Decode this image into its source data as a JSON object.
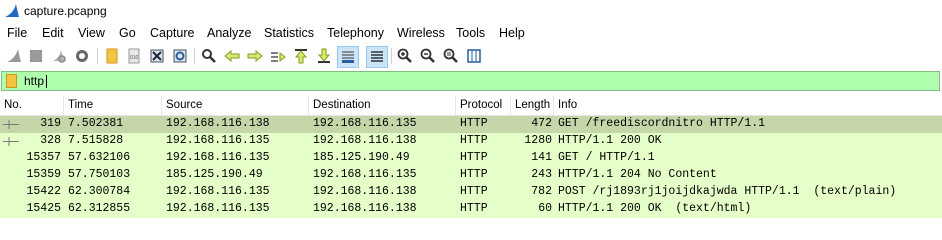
{
  "window": {
    "title": "capture.pcapng"
  },
  "menu": [
    "File",
    "Edit",
    "View",
    "Go",
    "Capture",
    "Analyze",
    "Statistics",
    "Telephony",
    "Wireless",
    "Tools",
    "Help"
  ],
  "toolbar": {
    "icons": [
      "shark-fin-start-icon",
      "stop-icon",
      "restart-icon",
      "options-gear-icon",
      "open-file-icon",
      "save-file-icon",
      "close-file-icon",
      "reload-icon",
      "find-icon",
      "go-back-icon",
      "go-forward-icon",
      "go-to-packet-icon",
      "first-packet-icon",
      "last-packet-icon",
      "autoscroll-icon",
      "colorize-icon",
      "zoom-in-icon",
      "zoom-out-icon",
      "normal-size-icon",
      "resize-columns-icon"
    ]
  },
  "filter": {
    "value": "http",
    "color": "#afffaf"
  },
  "columns": [
    "No.",
    "Time",
    "Source",
    "Destination",
    "Protocol",
    "Length",
    "Info"
  ],
  "packets": [
    {
      "no": "319",
      "time": "7.502381",
      "source": "192.168.116.138",
      "destination": "192.168.116.135",
      "protocol": "HTTP",
      "length": "472",
      "info": "GET /freediscordnitro HTTP/1.1",
      "selected": true
    },
    {
      "no": "328",
      "time": "7.515828",
      "source": "192.168.116.135",
      "destination": "192.168.116.138",
      "protocol": "HTTP",
      "length": "1280",
      "info": "HTTP/1.1 200 OK",
      "selected": false
    },
    {
      "no": "15357",
      "time": "57.632106",
      "source": "192.168.116.135",
      "destination": "185.125.190.49",
      "protocol": "HTTP",
      "length": "141",
      "info": "GET / HTTP/1.1",
      "selected": false
    },
    {
      "no": "15359",
      "time": "57.750103",
      "source": "185.125.190.49",
      "destination": "192.168.116.135",
      "protocol": "HTTP",
      "length": "243",
      "info": "HTTP/1.1 204 No Content",
      "selected": false
    },
    {
      "no": "15422",
      "time": "62.300784",
      "source": "192.168.116.135",
      "destination": "192.168.116.138",
      "protocol": "HTTP",
      "length": "782",
      "info": "POST /rj1893rj1joijdkajwda HTTP/1.1  (text/plain)",
      "selected": false
    },
    {
      "no": "15425",
      "time": "62.312855",
      "source": "192.168.116.135",
      "destination": "192.168.116.138",
      "protocol": "HTTP",
      "length": "60",
      "info": "HTTP/1.1 200 OK  (text/html)",
      "selected": false
    }
  ]
}
